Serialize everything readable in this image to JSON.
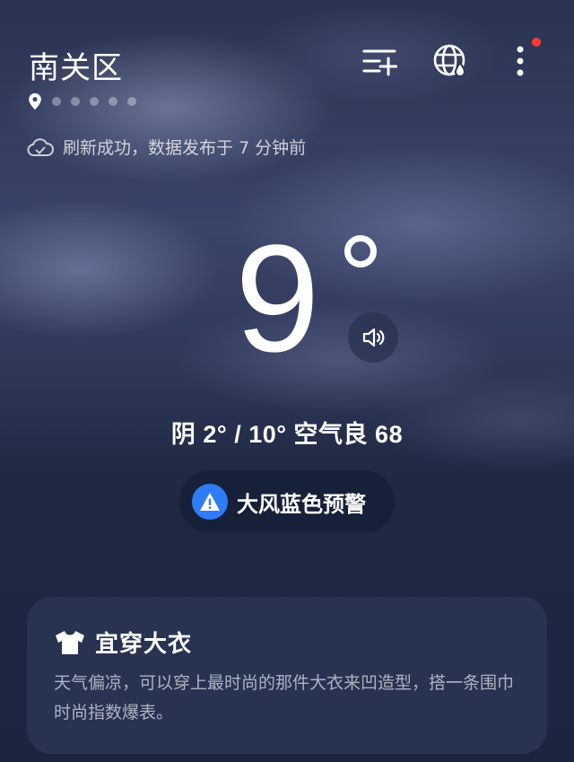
{
  "header": {
    "city": "南关区",
    "icons": [
      "add-city-icon",
      "globe-weather-icon",
      "more-icon"
    ],
    "notification_dot_color": "#ff3b30",
    "page_count": 6,
    "active_page": 0
  },
  "refresh": {
    "text": "刷新成功，数据发布于 7 分钟前",
    "icon": "cloud-check-icon"
  },
  "current": {
    "temperature": "9",
    "summary": "阴  2° / 10°  空气良 68"
  },
  "alert": {
    "label": "大风蓝色预警",
    "icon": "warning-icon",
    "color": "#2f7cf6"
  },
  "clothing": {
    "title": "宜穿大衣",
    "icon": "shirt-icon",
    "body": "天气偏凉，可以穿上最时尚的那件大衣来凹造型，搭一条围巾时尚指数爆表。"
  }
}
